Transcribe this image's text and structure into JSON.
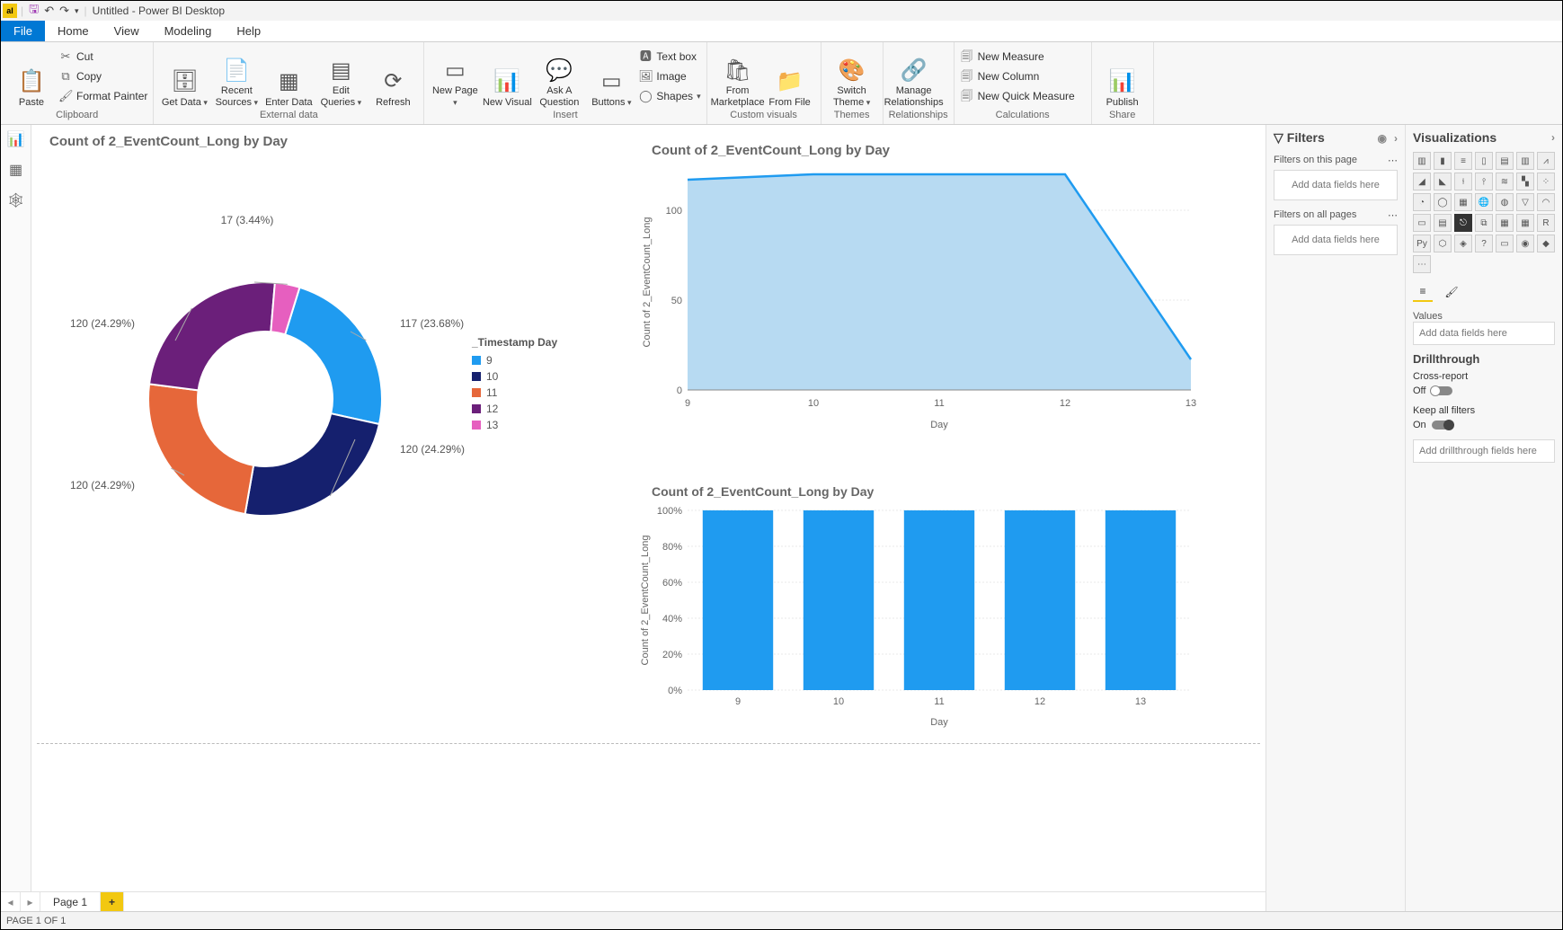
{
  "app": {
    "title": "Untitled - Power BI Desktop"
  },
  "menu": {
    "file": "File",
    "home": "Home",
    "view": "View",
    "modeling": "Modeling",
    "help": "Help"
  },
  "ribbon": {
    "clipboard": {
      "label": "Clipboard",
      "paste": "Paste",
      "cut": "Cut",
      "copy": "Copy",
      "format_painter": "Format Painter"
    },
    "external": {
      "label": "External data",
      "get_data": "Get Data",
      "recent_sources": "Recent Sources",
      "enter_data": "Enter Data",
      "edit_queries": "Edit Queries",
      "refresh": "Refresh"
    },
    "insert": {
      "label": "Insert",
      "new_page": "New Page",
      "new_visual": "New Visual",
      "ask_a_question": "Ask A Question",
      "buttons": "Buttons",
      "text_box": "Text box",
      "image": "Image",
      "shapes": "Shapes"
    },
    "custom": {
      "label": "Custom visuals",
      "marketplace": "From Marketplace",
      "file": "From File"
    },
    "themes": {
      "label": "Themes",
      "switch": "Switch Theme"
    },
    "rel": {
      "label": "Relationships",
      "manage": "Manage Relationships"
    },
    "calc": {
      "label": "Calculations",
      "measure": "New Measure",
      "column": "New Column",
      "quick": "New Quick Measure"
    },
    "share": {
      "label": "Share",
      "publish": "Publish"
    }
  },
  "filters": {
    "header": "Filters",
    "on_page": "Filters on this page",
    "on_all": "Filters on all pages",
    "add": "Add data fields here"
  },
  "viz": {
    "header": "Visualizations",
    "values": "Values",
    "add": "Add data fields here",
    "drill": "Drillthrough",
    "cross": "Cross-report",
    "off": "Off",
    "keep": "Keep all filters",
    "on": "On",
    "drill_add": "Add drillthrough fields here"
  },
  "pages": {
    "page1": "Page 1",
    "add": "+"
  },
  "status": {
    "text": "PAGE 1 OF 1"
  },
  "chart_data": [
    {
      "type": "pie",
      "title": "Count of 2_EventCount_Long by Day",
      "legend_title": "_Timestamp Day",
      "categories": [
        "9",
        "10",
        "11",
        "12",
        "13"
      ],
      "values": [
        117,
        120,
        120,
        120,
        17
      ],
      "percents": [
        23.68,
        24.29,
        24.29,
        24.29,
        3.44
      ],
      "colors": [
        "#1f9bf0",
        "#15206e",
        "#e6673a",
        "#6b1f7a",
        "#e65fbf"
      ],
      "data_labels": [
        "117 (23.68%)",
        "120 (24.29%)",
        "120 (24.29%)",
        "120 (24.29%)",
        "17 (3.44%)"
      ]
    },
    {
      "type": "area",
      "title": "Count of 2_EventCount_Long by Day",
      "xlabel": "Day",
      "ylabel": "Count of 2_EventCount_Long",
      "x": [
        9,
        10,
        11,
        12,
        13
      ],
      "y": [
        117,
        120,
        120,
        120,
        17
      ],
      "y_ticks": [
        0,
        50,
        100
      ],
      "x_ticks": [
        9,
        10,
        11,
        12,
        13
      ],
      "ylim": [
        0,
        120
      ],
      "line_color": "#1f9bf0",
      "fill_color": "#b7daf2"
    },
    {
      "type": "bar",
      "title": "Count of 2_EventCount_Long by Day",
      "xlabel": "Day",
      "ylabel": "Count of 2_EventCount_Long",
      "categories": [
        "9",
        "10",
        "11",
        "12",
        "13"
      ],
      "values": [
        100,
        100,
        100,
        100,
        100
      ],
      "y_ticks": [
        "0%",
        "20%",
        "40%",
        "60%",
        "80%",
        "100%"
      ],
      "ylim": [
        0,
        100
      ],
      "bar_color": "#1f9bf0"
    }
  ]
}
